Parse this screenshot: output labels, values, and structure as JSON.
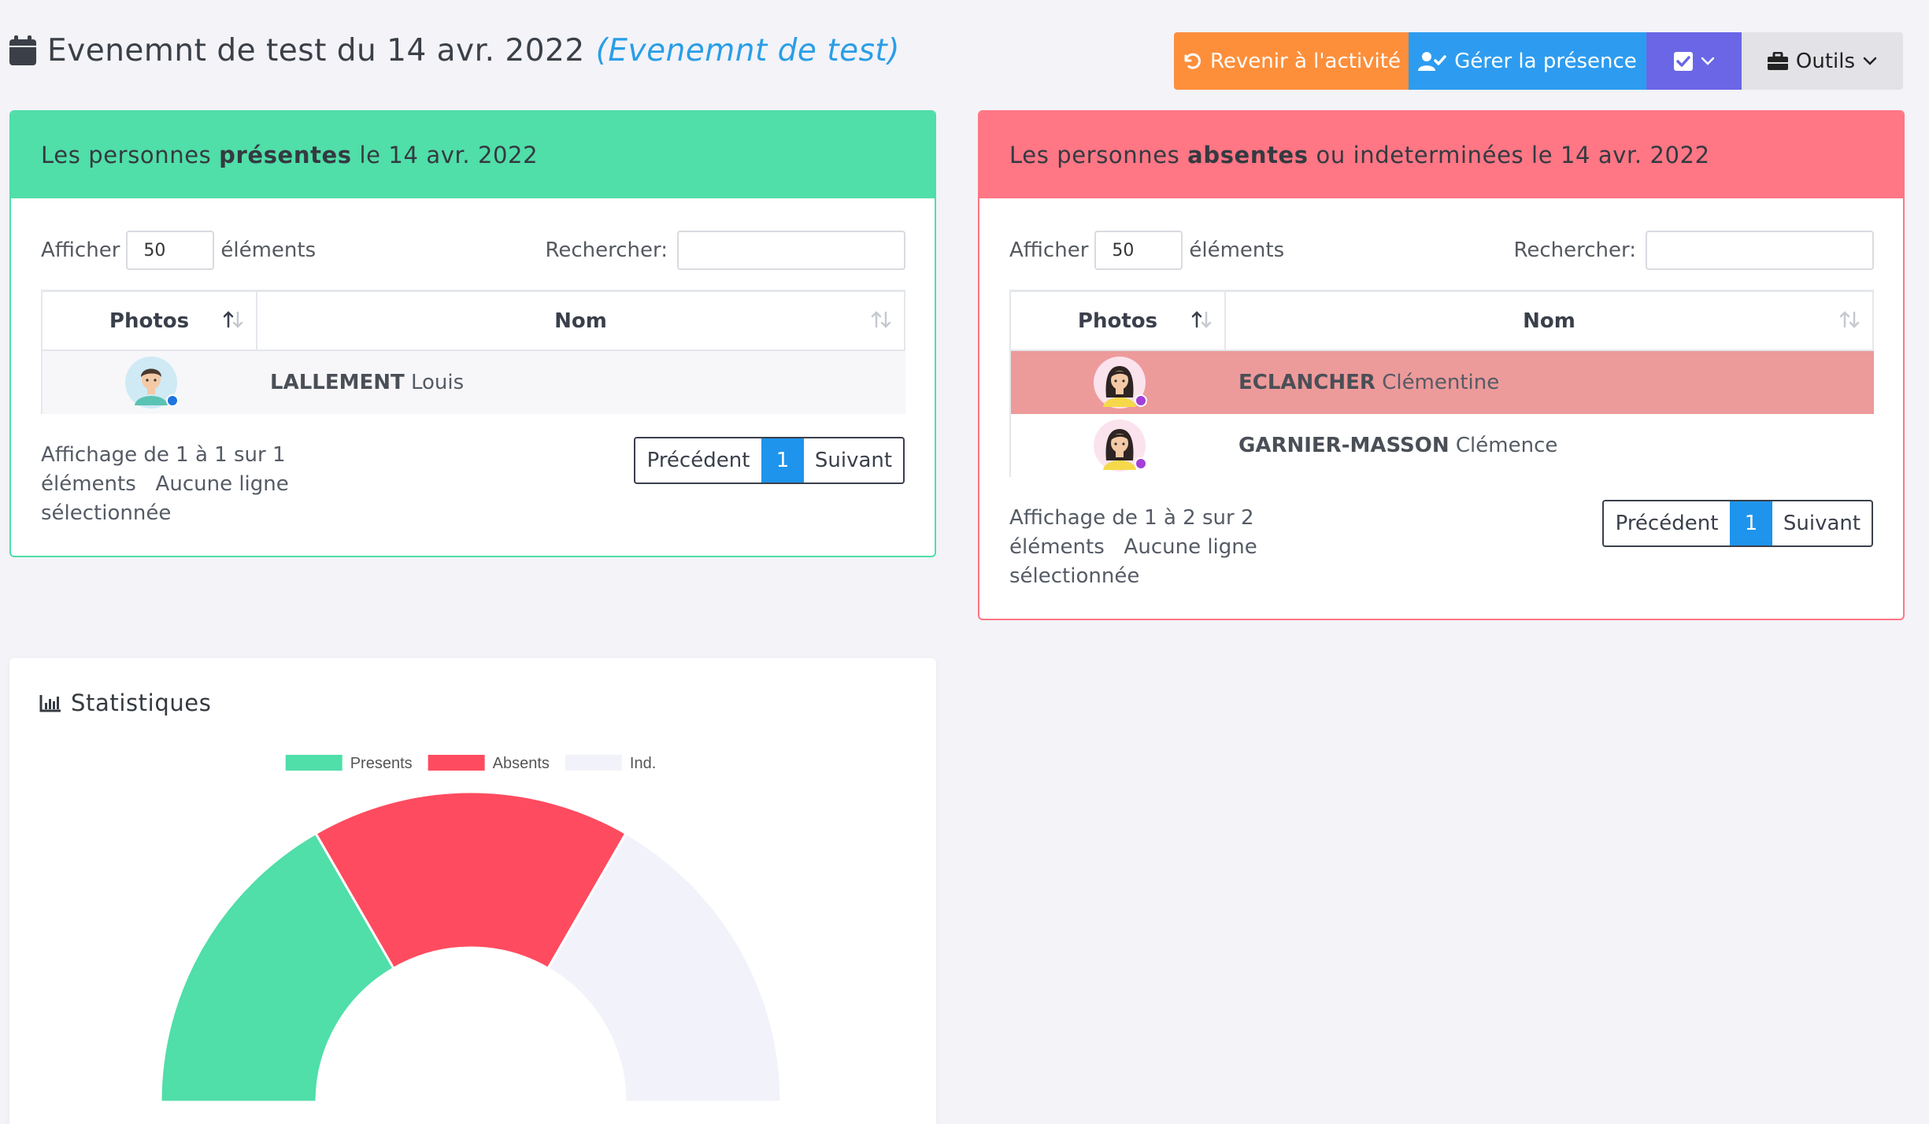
{
  "header": {
    "title": "Evenemnt de test du 14 avr. 2022",
    "subtitle": "(Evenemnt de test)"
  },
  "toolbar": {
    "back_label": "Revenir à l'activité",
    "presence_label": "Gérer la présence",
    "tools_label": "Outils"
  },
  "present": {
    "title_pre": "Les personnes ",
    "title_bold": "présentes",
    "title_post": " le 14 avr. 2022",
    "show_label": "Afficher",
    "page_length": "50",
    "elements_label": "éléments",
    "search_label": "Rechercher:",
    "col_photos": "Photos",
    "col_nom": "Nom",
    "rows": [
      {
        "last": "LALLEMENT",
        "first": "Louis"
      }
    ],
    "info_line1": "Affichage de 1 à 1 sur 1",
    "info_line2": "éléments   Aucune ligne",
    "info_line3": "sélectionnée",
    "prev": "Précédent",
    "page": "1",
    "next": "Suivant"
  },
  "absent": {
    "title_pre": "Les personnes ",
    "title_bold": "absentes",
    "title_post": " ou indeterminées le 14 avr. 2022",
    "show_label": "Afficher",
    "page_length": "50",
    "elements_label": "éléments",
    "search_label": "Rechercher:",
    "col_photos": "Photos",
    "col_nom": "Nom",
    "rows": [
      {
        "last": "ECLANCHER",
        "first": "Clémentine"
      },
      {
        "last": "GARNIER-MASSON",
        "first": "Clémence"
      }
    ],
    "info_line1": "Affichage de 1 à 2 sur 2",
    "info_line2": "éléments   Aucune ligne",
    "info_line3": "sélectionnée",
    "prev": "Précédent",
    "page": "1",
    "next": "Suivant"
  },
  "stats": {
    "title": "Statistiques"
  },
  "colors": {
    "present": "#50dea9",
    "absent": "#ff4b5f",
    "ind": "#f2f2fa",
    "accent": "#1e94ec"
  },
  "chart_data": {
    "type": "pie",
    "variant": "half-doughnut",
    "labels": [
      "Presents",
      "Absents",
      "Ind."
    ],
    "values": [
      1,
      1,
      1
    ],
    "colors": [
      "#50dea9",
      "#ff4b5f",
      "#f2f2fa"
    ],
    "legend": "top"
  }
}
